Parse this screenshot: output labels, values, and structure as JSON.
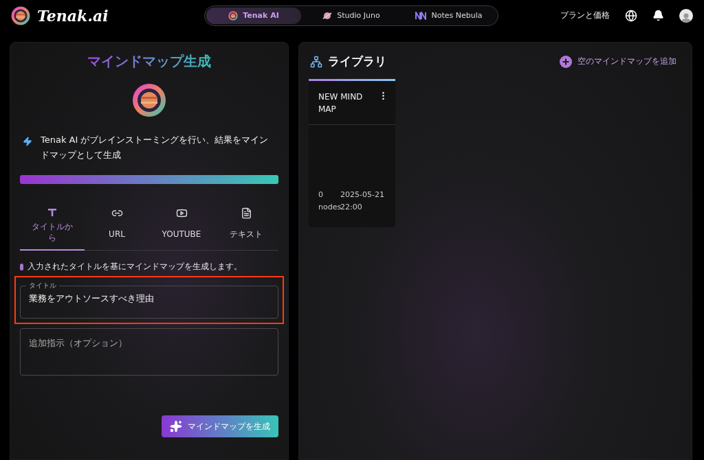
{
  "header": {
    "brand": "Tenak.ai",
    "apps": [
      {
        "label": "Tenak AI",
        "selected": true,
        "kind": "planet"
      },
      {
        "label": "Studio Juno",
        "selected": false,
        "kind": "juno"
      },
      {
        "label": "Notes Nebula",
        "selected": false,
        "kind": "nebula"
      }
    ],
    "pricing_link": "プランと価格"
  },
  "generator": {
    "title": "マインドマップ生成",
    "description": "Tenak AI がブレインストーミングを行い、結果をマインドマップとして生成",
    "tabs": [
      {
        "label": "タイトルから",
        "kind": "title",
        "selected": true
      },
      {
        "label": "URL",
        "kind": "link",
        "selected": false
      },
      {
        "label": "YOUTUBE",
        "kind": "video",
        "selected": false
      },
      {
        "label": "テキスト",
        "kind": "text",
        "selected": false
      }
    ],
    "hint": "入力されたタイトルを基にマインドマップを生成します。",
    "title_field": {
      "label": "タイトル",
      "value": "業務をアウトソースすべき理由",
      "highlighted": true
    },
    "instructions_field": {
      "placeholder": "追加指示（オプション）"
    },
    "generate_button": "マインドマップを生成"
  },
  "library": {
    "title": "ライブラリ",
    "add_button": "空のマインドマップを追加",
    "maps": [
      {
        "title": "NEW MIND MAP",
        "nodes": "0 nodes",
        "updated": "2025-05-21 22:00"
      }
    ]
  }
}
